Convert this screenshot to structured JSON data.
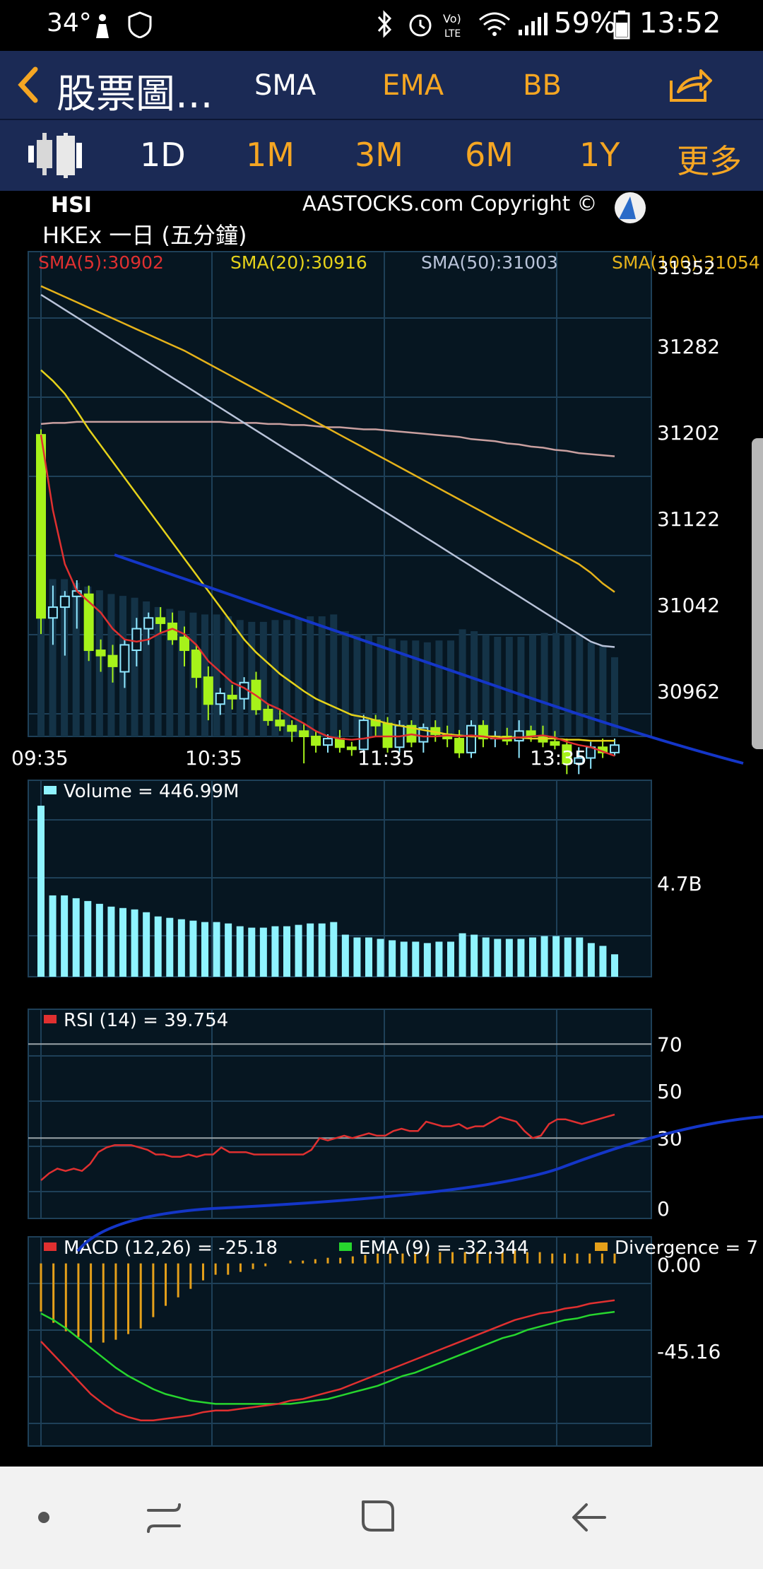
{
  "status_bar": {
    "temperature": "34°",
    "battery": "59%",
    "time": "13:52",
    "left_icons": [
      "person-icon",
      "shield-icon"
    ],
    "right_icons": [
      "bluetooth-icon",
      "alarm-icon",
      "volte-icon",
      "wifi-icon",
      "signal-icon",
      "battery-icon"
    ]
  },
  "toolbar": {
    "title": "股票圖...",
    "sma": "SMA",
    "ema": "EMA",
    "bb": "BB"
  },
  "periods": [
    "1D",
    "1M",
    "3M",
    "6M",
    "1Y",
    "更多"
  ],
  "chart_header": {
    "symbol": "HSI",
    "copyright": "AASTOCKS.com Copyright ©",
    "subtitle": "HKEx 一日 (五分鐘)"
  },
  "colors": {
    "accent": "#f5a623",
    "header_bg": "#1b2a55",
    "chart_bg": "#061621",
    "grid": "#1e4058",
    "candle": "#a6f21a",
    "sma5": "#e03030",
    "sma20": "#e5d21a",
    "sma50": "#b9c3d9",
    "sma100": "#c9a0a0",
    "sma_gold": "#e5b21a",
    "volume": "#8ff3ff",
    "trend": "#1436c8"
  },
  "chart_data": [
    {
      "type": "line",
      "name": "price",
      "x_ticks": [
        "09:35",
        "10:35",
        "11:35",
        "13:35"
      ],
      "y_ticks": [
        31282,
        31202,
        31122,
        31042,
        30962
      ],
      "y_top_label": "31352",
      "ylim": [
        30920,
        31370
      ],
      "legend": [
        {
          "label": "SMA(5):30902",
          "color": "#e03030"
        },
        {
          "label": "SMA(20):30916",
          "color": "#e5d21a"
        },
        {
          "label": "SMA(50):31003",
          "color": "#b9c3d9"
        },
        {
          "label": "SMA(100):31054",
          "color": "#e5b21a"
        }
      ],
      "candles": [
        {
          "o": 31200,
          "h": 31205,
          "l": 31015,
          "c": 31030
        },
        {
          "o": 31030,
          "h": 31060,
          "l": 31005,
          "c": 31040
        },
        {
          "o": 31040,
          "h": 31055,
          "l": 30995,
          "c": 31050
        },
        {
          "o": 31050,
          "h": 31065,
          "l": 31020,
          "c": 31055
        },
        {
          "o": 31052,
          "h": 31060,
          "l": 30990,
          "c": 31000
        },
        {
          "o": 31000,
          "h": 31010,
          "l": 30980,
          "c": 30995
        },
        {
          "o": 30995,
          "h": 31005,
          "l": 30970,
          "c": 30985
        },
        {
          "o": 30980,
          "h": 31010,
          "l": 30965,
          "c": 31005
        },
        {
          "o": 31000,
          "h": 31030,
          "l": 30985,
          "c": 31020
        },
        {
          "o": 31020,
          "h": 31035,
          "l": 31005,
          "c": 31030
        },
        {
          "o": 31030,
          "h": 31040,
          "l": 31015,
          "c": 31025
        },
        {
          "o": 31025,
          "h": 31035,
          "l": 31005,
          "c": 31010
        },
        {
          "o": 31012,
          "h": 31022,
          "l": 30985,
          "c": 31000
        },
        {
          "o": 31000,
          "h": 31005,
          "l": 30965,
          "c": 30975
        },
        {
          "o": 30975,
          "h": 30985,
          "l": 30935,
          "c": 30950
        },
        {
          "o": 30950,
          "h": 30965,
          "l": 30940,
          "c": 30960
        },
        {
          "o": 30958,
          "h": 30968,
          "l": 30945,
          "c": 30955
        },
        {
          "o": 30955,
          "h": 30975,
          "l": 30945,
          "c": 30970
        },
        {
          "o": 30972,
          "h": 30980,
          "l": 30940,
          "c": 30945
        },
        {
          "o": 30945,
          "h": 30950,
          "l": 30930,
          "c": 30935
        },
        {
          "o": 30935,
          "h": 30945,
          "l": 30925,
          "c": 30930
        },
        {
          "o": 30930,
          "h": 30935,
          "l": 30915,
          "c": 30925
        },
        {
          "o": 30925,
          "h": 30932,
          "l": 30895,
          "c": 30920
        },
        {
          "o": 30920,
          "h": 30925,
          "l": 30905,
          "c": 30912
        },
        {
          "o": 30912,
          "h": 30922,
          "l": 30905,
          "c": 30918
        },
        {
          "o": 30918,
          "h": 30926,
          "l": 30905,
          "c": 30910
        },
        {
          "o": 30910,
          "h": 30915,
          "l": 30902,
          "c": 30908
        },
        {
          "o": 30908,
          "h": 30940,
          "l": 30905,
          "c": 30935
        },
        {
          "o": 30935,
          "h": 30940,
          "l": 30920,
          "c": 30930
        },
        {
          "o": 30932,
          "h": 30938,
          "l": 30905,
          "c": 30910
        },
        {
          "o": 30910,
          "h": 30935,
          "l": 30905,
          "c": 30930
        },
        {
          "o": 30930,
          "h": 30935,
          "l": 30910,
          "c": 30915
        },
        {
          "o": 30915,
          "h": 30932,
          "l": 30905,
          "c": 30928
        },
        {
          "o": 30928,
          "h": 30935,
          "l": 30915,
          "c": 30922
        },
        {
          "o": 30922,
          "h": 30930,
          "l": 30910,
          "c": 30918
        },
        {
          "o": 30918,
          "h": 30926,
          "l": 30900,
          "c": 30905
        },
        {
          "o": 30905,
          "h": 30935,
          "l": 30900,
          "c": 30930
        },
        {
          "o": 30930,
          "h": 30935,
          "l": 30910,
          "c": 30918
        },
        {
          "o": 30918,
          "h": 30925,
          "l": 30910,
          "c": 30920
        },
        {
          "o": 30920,
          "h": 30928,
          "l": 30912,
          "c": 30916
        },
        {
          "o": 30916,
          "h": 30935,
          "l": 30900,
          "c": 30925
        },
        {
          "o": 30925,
          "h": 30930,
          "l": 30915,
          "c": 30920
        },
        {
          "o": 30920,
          "h": 30930,
          "l": 30910,
          "c": 30915
        },
        {
          "o": 30915,
          "h": 30925,
          "l": 30908,
          "c": 30912
        },
        {
          "o": 30912,
          "h": 30918,
          "l": 30885,
          "c": 30895
        },
        {
          "o": 30895,
          "h": 30910,
          "l": 30885,
          "c": 30900
        },
        {
          "o": 30900,
          "h": 30915,
          "l": 30890,
          "c": 30910
        },
        {
          "o": 30910,
          "h": 30918,
          "l": 30900,
          "c": 30905
        },
        {
          "o": 30905,
          "h": 30918,
          "l": 30902,
          "c": 30912
        }
      ],
      "sma5": [
        31200,
        31130,
        31080,
        31055,
        31045,
        31035,
        31020,
        31010,
        31008,
        31010,
        31016,
        31020,
        31015,
        31005,
        30990,
        30980,
        30970,
        30965,
        30958,
        30950,
        30945,
        30938,
        30932,
        30925,
        30920,
        30918,
        30917,
        30918,
        30920,
        30920,
        30920,
        30922,
        30920,
        30920,
        30921,
        30920,
        30921,
        30920,
        30918,
        30918,
        30919,
        30920,
        30921,
        30919,
        30915,
        30912,
        30910,
        30906,
        30902
      ],
      "sma20": [
        31260,
        31250,
        31238,
        31222,
        31205,
        31190,
        31175,
        31160,
        31145,
        31130,
        31115,
        31100,
        31085,
        31070,
        31055,
        31040,
        31025,
        31010,
        30998,
        30988,
        30978,
        30970,
        30962,
        30955,
        30950,
        30945,
        30940,
        30938,
        30935,
        30932,
        30930,
        30928,
        30926,
        30924,
        30922,
        30921,
        30920,
        30920,
        30920,
        30919,
        30919,
        30918,
        30918,
        30918,
        30917,
        30917,
        30916,
        30916,
        30916
      ],
      "sma50": [
        31330,
        31323,
        31316,
        31309,
        31302,
        31295,
        31288,
        31281,
        31274,
        31267,
        31260,
        31253,
        31246,
        31239,
        31232,
        31225,
        31218,
        31211,
        31204,
        31197,
        31190,
        31183,
        31176,
        31169,
        31162,
        31155,
        31148,
        31141,
        31134,
        31127,
        31120,
        31113,
        31106,
        31099,
        31092,
        31085,
        31078,
        31071,
        31064,
        31057,
        31050,
        31043,
        31036,
        31029,
        31022,
        31015,
        31008,
        31004,
        31003
      ],
      "sma100": [
        31338,
        31333,
        31328,
        31323,
        31318,
        31313,
        31308,
        31303,
        31298,
        31293,
        31288,
        31283,
        31278,
        31272,
        31266,
        31260,
        31254,
        31248,
        31242,
        31236,
        31230,
        31224,
        31218,
        31212,
        31206,
        31200,
        31194,
        31188,
        31182,
        31176,
        31170,
        31164,
        31158,
        31152,
        31146,
        31140,
        31134,
        31128,
        31122,
        31116,
        31110,
        31104,
        31098,
        31092,
        31086,
        31080,
        31072,
        31062,
        31054
      ],
      "sma_flat": [
        31210,
        31211,
        31211,
        31212,
        31212,
        31212,
        31212,
        31212,
        31212,
        31212,
        31212,
        31212,
        31212,
        31212,
        31212,
        31212,
        31211,
        31211,
        31211,
        31210,
        31210,
        31209,
        31209,
        31208,
        31207,
        31207,
        31206,
        31205,
        31205,
        31204,
        31203,
        31202,
        31201,
        31200,
        31199,
        31198,
        31196,
        31195,
        31194,
        31192,
        31191,
        31189,
        31188,
        31186,
        31185,
        31183,
        31182,
        31181,
        31180
      ]
    },
    {
      "type": "bar",
      "name": "volume",
      "legend": "Volume  = 446.99M",
      "y_tick": "4.7B",
      "values": [
        12.2,
        5.8,
        5.8,
        5.6,
        5.4,
        5.2,
        5.0,
        4.9,
        4.8,
        4.6,
        4.3,
        4.2,
        4.1,
        4.0,
        3.9,
        3.9,
        3.8,
        3.6,
        3.5,
        3.5,
        3.6,
        3.6,
        3.7,
        3.8,
        3.8,
        3.9,
        3.0,
        2.8,
        2.8,
        2.7,
        2.6,
        2.5,
        2.5,
        2.4,
        2.5,
        2.5,
        3.1,
        3.0,
        2.8,
        2.7,
        2.7,
        2.7,
        2.8,
        2.9,
        2.9,
        2.8,
        2.8,
        2.4,
        2.2,
        1.6
      ],
      "ylim": [
        0,
        12.5
      ]
    },
    {
      "type": "line",
      "name": "rsi",
      "legend": "RSI (14)  = 39.754",
      "y_ticks": [
        70,
        50,
        30,
        0
      ],
      "ylim": [
        0,
        80
      ],
      "reference": [
        70,
        30
      ],
      "values": [
        12,
        15,
        17,
        16,
        17,
        16,
        19,
        24,
        26,
        27,
        27,
        27,
        26,
        25,
        23,
        23,
        22,
        22,
        23,
        22,
        23,
        23,
        26,
        24,
        24,
        24,
        23,
        23,
        23,
        23,
        23,
        23,
        23,
        25,
        30,
        29,
        30,
        31,
        30,
        31,
        32,
        31,
        31,
        33,
        34,
        33,
        33,
        37,
        36,
        35,
        35,
        36,
        34,
        35,
        35,
        37,
        39,
        38,
        37,
        33,
        30,
        31,
        36,
        38,
        38,
        37,
        36,
        37,
        38,
        39,
        40
      ]
    },
    {
      "type": "line",
      "name": "macd",
      "legend": [
        {
          "label": "MACD (12,26) = -25.18",
          "color": "#e03030"
        },
        {
          "label": "EMA (9) = -32.344",
          "color": "#27d62e"
        },
        {
          "label": "Divergence = 7",
          "color": "#e5a01a"
        }
      ],
      "y_ticks": [
        "0.00",
        "-45.16"
      ],
      "ylim": [
        -105,
        5
      ],
      "macd": [
        -50,
        -58,
        -66,
        -74,
        -82,
        -88,
        -93,
        -96,
        -98,
        -98,
        -97,
        -96,
        -95,
        -93,
        -92,
        -92,
        -91,
        -90,
        -89,
        -88,
        -86,
        -85,
        -83,
        -81,
        -79,
        -76,
        -73,
        -70,
        -67,
        -64,
        -61,
        -58,
        -55,
        -52,
        -49,
        -46,
        -43,
        -40,
        -37,
        -35,
        -33,
        -32,
        -30,
        -29,
        -27,
        -26,
        -25
      ],
      "ema9": [
        -33,
        -37,
        -42,
        -48,
        -54,
        -60,
        -66,
        -71,
        -75,
        -79,
        -82,
        -84,
        -86,
        -87,
        -88,
        -88,
        -88,
        -88,
        -88,
        -88,
        -88,
        -87,
        -86,
        -85,
        -83,
        -81,
        -79,
        -77,
        -74,
        -71,
        -69,
        -66,
        -63,
        -60,
        -57,
        -54,
        -51,
        -48,
        -46,
        -43,
        -41,
        -39,
        -37,
        -36,
        -34,
        -33,
        -32
      ],
      "divergence": [
        -17,
        -21,
        -24,
        -26,
        -28,
        -28,
        -27,
        -25,
        -23,
        -19,
        -15,
        -12,
        -9,
        -6,
        -4,
        -4,
        -3,
        -2,
        -1,
        0,
        2,
        2,
        3,
        4,
        4,
        5,
        6,
        7,
        7,
        7,
        8,
        8,
        8,
        8,
        8,
        8,
        8,
        8,
        9,
        8,
        8,
        7,
        7,
        7,
        7,
        7,
        7
      ]
    }
  ],
  "navbar": {
    "icons": [
      "dot-icon",
      "recent-apps-icon",
      "home-icon",
      "back-icon"
    ]
  }
}
